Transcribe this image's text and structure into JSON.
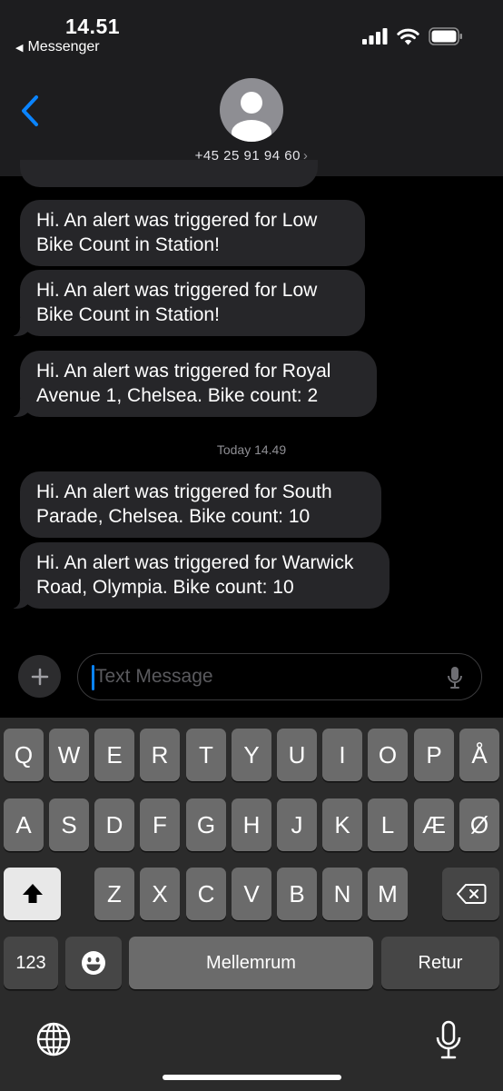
{
  "status_bar": {
    "time": "14.51",
    "back_app": "Messenger"
  },
  "header": {
    "contact_number": "+45 25 91 94 60",
    "chevron": "›"
  },
  "messages": [
    {
      "text": "Hi. An alert was triggered for Low Bike Count in Station!"
    },
    {
      "text": "Hi. An alert was triggered for Low Bike Count in Station!"
    },
    {
      "text": "Hi. An alert was triggered for Royal Avenue 1, Chelsea. Bike count: 2"
    },
    {
      "text": "Hi. An alert was triggered for South Parade, Chelsea. Bike count: 10"
    },
    {
      "text": "Hi. An alert was triggered for Warwick Road, Olympia. Bike count: 10"
    }
  ],
  "timestamp": "Today 14.49",
  "input": {
    "placeholder": "Text Message"
  },
  "keyboard": {
    "row1": [
      "Q",
      "W",
      "E",
      "R",
      "T",
      "Y",
      "U",
      "I",
      "O",
      "P",
      "Å"
    ],
    "row2": [
      "A",
      "S",
      "D",
      "F",
      "G",
      "H",
      "J",
      "K",
      "L",
      "Æ",
      "Ø"
    ],
    "row3": [
      "Z",
      "X",
      "C",
      "V",
      "B",
      "N",
      "M"
    ],
    "numbers_label": "123",
    "space_label": "Mellemrum",
    "return_label": "Retur"
  },
  "colors": {
    "bubble": "#262629",
    "accent": "#0a84ff",
    "keyboard_bg": "#2b2b2b",
    "key": "#6b6b6b"
  }
}
